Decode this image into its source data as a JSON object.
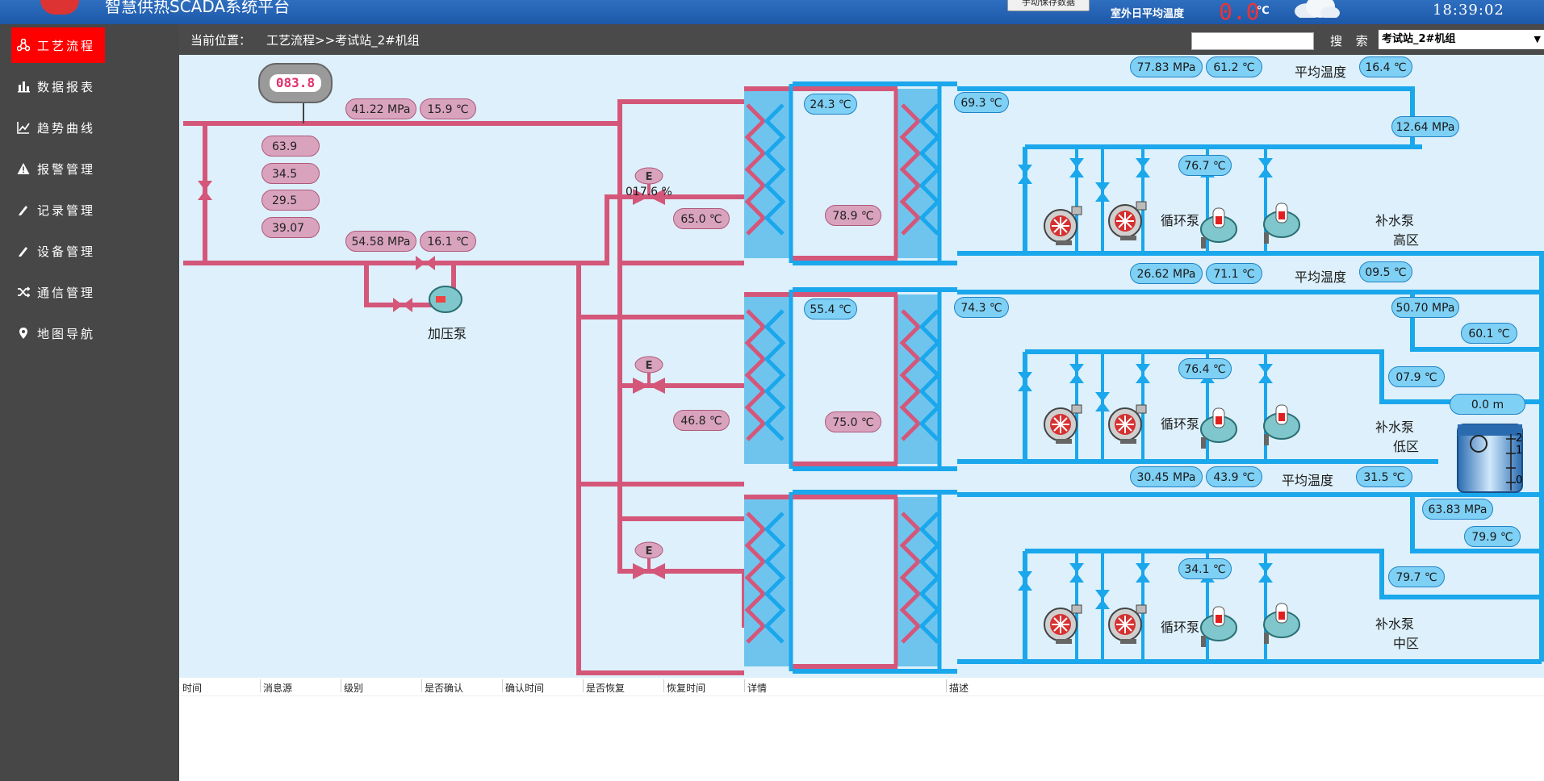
{
  "app": {
    "title": "智慧供热SCADA系统平台",
    "save_button": "手动保存数据",
    "outdoor_label": "室外日平均温度",
    "outdoor_value": "0.0",
    "outdoor_unit": "℃",
    "clock": "18:39:02"
  },
  "sidebar": {
    "items": [
      {
        "label": "工艺流程",
        "icon": "process-icon"
      },
      {
        "label": "数据报表",
        "icon": "bar-chart-icon"
      },
      {
        "label": "趋势曲线",
        "icon": "line-chart-icon"
      },
      {
        "label": "报警管理",
        "icon": "warning-icon"
      },
      {
        "label": "记录管理",
        "icon": "pen-icon"
      },
      {
        "label": "设备管理",
        "icon": "pen-icon"
      },
      {
        "label": "通信管理",
        "icon": "shuffle-icon"
      },
      {
        "label": "地图导航",
        "icon": "map-pin-icon"
      }
    ]
  },
  "breadcrumb": {
    "label": "当前位置：",
    "path": "工艺流程>>考试站_2#机组"
  },
  "search": {
    "label": "搜 索",
    "value": "",
    "station": "考试站_2#机组"
  },
  "primary": {
    "meter_reading": "083.8",
    "inlet_pressure": "41.22  MPa",
    "inlet_temp": "15.9 ℃",
    "values": [
      "63.9",
      "34.5",
      "29.5",
      "39.07"
    ],
    "return_pressure": "54.58  MPa",
    "return_temp": "16.1 ℃",
    "booster_pump_label": "加压泵",
    "valve_open_pct": "017.6 %"
  },
  "zones": [
    {
      "name": "高区",
      "hx_primary_in": "65.0 ℃",
      "hx_primary_top": "24.3 ℃",
      "hx_primary_mid": "78.9 ℃",
      "hx_secondary_out": "69.3 ℃",
      "supply_pressure": "77.83 MPa",
      "supply_temp": "61.2 ℃",
      "avg_temp_label": "平均温度",
      "avg_temp": "16.4 ℃",
      "return_pressure": "12.64  MPa",
      "pump_temp": "76.7 ℃",
      "circ_pump_label": "循环泵",
      "makeup_pump_label": "补水泵"
    },
    {
      "name": "低区",
      "hx_primary_in": "46.8 ℃",
      "hx_primary_top": "55.4 ℃",
      "hx_primary_mid": "75.0 ℃",
      "hx_secondary_out": "74.3 ℃",
      "supply_pressure": "26.62  MPa",
      "supply_temp": "71.1 ℃",
      "avg_temp_label": "平均温度",
      "avg_temp": "09.5 ℃",
      "return_pressure": "50.70  MPa",
      "return_temp": "60.1 ℃",
      "pump_temp": "76.4 ℃",
      "makeup_temp": "07.9 ℃",
      "circ_pump_label": "循环泵",
      "makeup_pump_label": "补水泵"
    },
    {
      "name": "中区",
      "supply_pressure": "30.45  MPa",
      "supply_temp": "43.9 ℃",
      "avg_temp_label": "平均温度",
      "avg_temp": "31.5 ℃",
      "return_pressure": "63.83  MPa",
      "return_temp": "79.9 ℃",
      "pump_temp": "34.1 ℃",
      "makeup_temp": "79.7 ℃",
      "circ_pump_label": "循环泵",
      "makeup_pump_label": "补水泵"
    }
  ],
  "tank": {
    "level": "0.0   m",
    "scale": [
      "2",
      "1",
      "0"
    ]
  },
  "alarm_table": {
    "columns": [
      "时间",
      "消息源",
      "级别",
      "是否确认",
      "确认时间",
      "是否恢复",
      "恢复时间",
      "详情",
      "描述"
    ]
  },
  "colors": {
    "primary_pipe": "#d4577a",
    "secondary_pipe": "#1aa7ec",
    "active_nav": "#ff0000",
    "diagram_bg": "#ddf0fb"
  }
}
